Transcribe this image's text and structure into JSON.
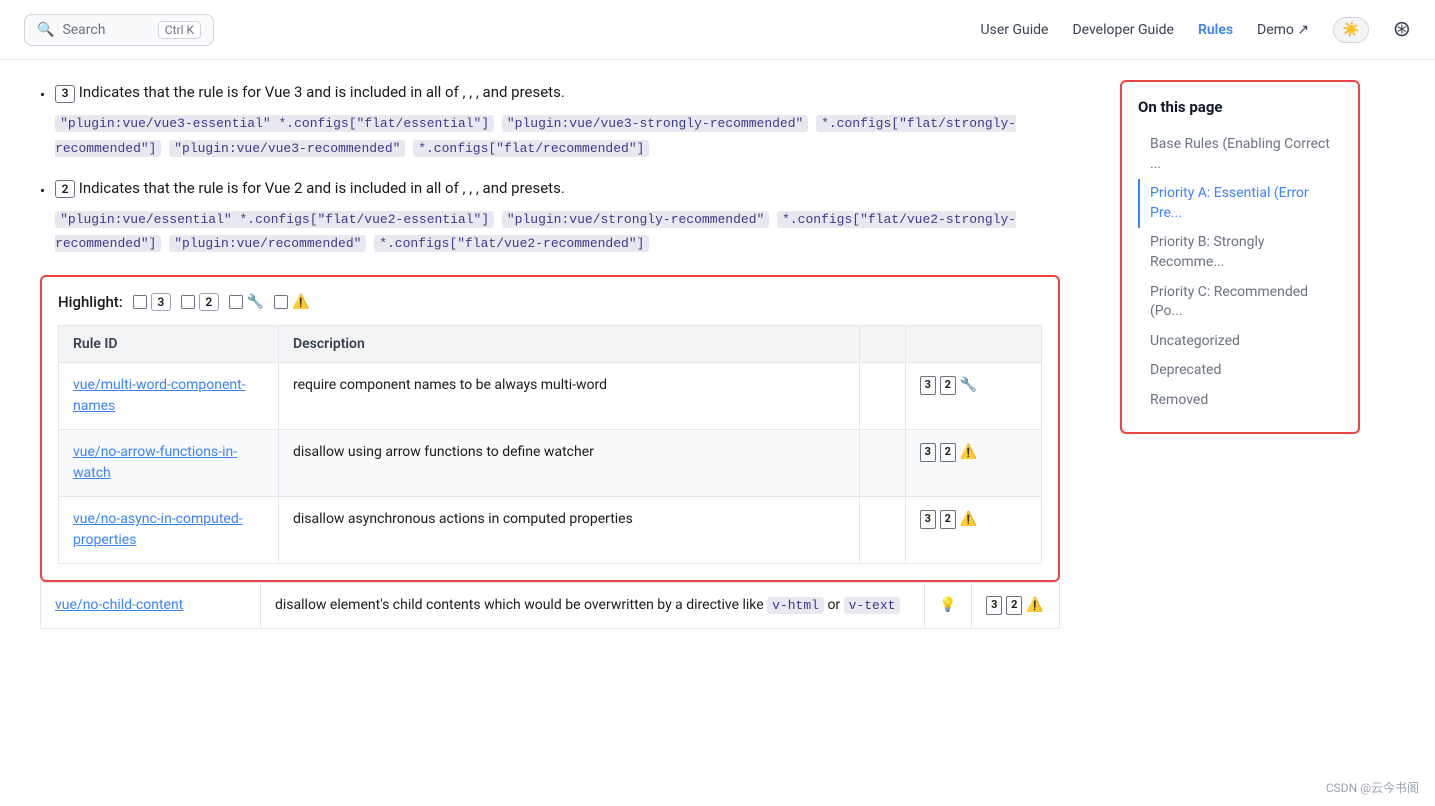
{
  "header": {
    "search_placeholder": "Search",
    "search_kbd": "Ctrl K",
    "nav_items": [
      {
        "label": "User Guide",
        "active": false
      },
      {
        "label": "Developer Guide",
        "active": false
      },
      {
        "label": "Rules",
        "active": true
      },
      {
        "label": "Demo ↗",
        "active": false
      }
    ]
  },
  "bullet_section": {
    "item1": {
      "badge": "3",
      "text": "Indicates that the rule is for Vue 3 and is included in all of",
      "text2": ", , , and",
      "presets": "presets.",
      "codes": [
        "\"plugin:vue/vue3-essential\" *.configs[\"flat/essential\"]",
        "\"plugin:vue/vue3-strongly-recommended\" *.configs[\"flat/strongly-recommended\"]",
        "\"plugin:vue/vue3-recommended\" *.configs[\"flat/recommended\"]"
      ]
    },
    "item2": {
      "badge": "2",
      "text": "Indicates that the rule is for Vue 2 and is included in all of",
      "text2": ", , , and",
      "presets": "presets.",
      "codes": [
        "\"plugin:vue/essential\" *.configs[\"flat/vue2-essential\"]",
        "\"plugin:vue/strongly-recommended\" *.configs[\"flat/vue2-strongly-recommended\"]",
        "\"plugin:vue/recommended\" *.configs[\"flat/vue2-recommended\"]"
      ]
    }
  },
  "highlight": {
    "label": "Highlight:",
    "filters": [
      {
        "id": "v3",
        "badge": "3"
      },
      {
        "id": "v2",
        "badge": "2"
      },
      {
        "id": "wrench",
        "icon": "🔧"
      },
      {
        "id": "warning",
        "icon": "⚠️"
      }
    ]
  },
  "table": {
    "columns": [
      "Rule ID",
      "Description",
      "",
      ""
    ],
    "rows": [
      {
        "id": "vue/multi-word-component-names",
        "description": "require component names to be always multi-word",
        "badges": [
          "3",
          "2"
        ],
        "icons": [
          "wrench"
        ]
      },
      {
        "id": "vue/no-arrow-functions-in-watch",
        "description": "disallow using arrow functions to define watcher",
        "badges": [
          "3",
          "2"
        ],
        "icons": [
          "warning"
        ]
      },
      {
        "id": "vue/no-async-in-computed-properties",
        "description": "disallow asynchronous actions in computed properties",
        "badges": [
          "3",
          "2"
        ],
        "icons": [
          "warning"
        ]
      },
      {
        "id": "vue/no-child-content",
        "description_parts": [
          "disallow element's child contents which would be overwritten by a directive like",
          "v-html",
          "or",
          "v-text"
        ],
        "badges": [
          "3",
          "2"
        ],
        "icons": [
          "bulb",
          "warning"
        ]
      }
    ]
  },
  "toc": {
    "title": "On this page",
    "items": [
      {
        "label": "Base Rules (Enabling Correct ...",
        "active": false
      },
      {
        "label": "Priority A: Essential (Error Pre...",
        "active": true
      },
      {
        "label": "Priority B: Strongly Recomme...",
        "active": false
      },
      {
        "label": "Priority C: Recommended (Po...",
        "active": false
      },
      {
        "label": "Uncategorized",
        "active": false
      },
      {
        "label": "Deprecated",
        "active": false
      },
      {
        "label": "Removed",
        "active": false
      }
    ]
  },
  "watermark": "CSDN @云今书阁"
}
